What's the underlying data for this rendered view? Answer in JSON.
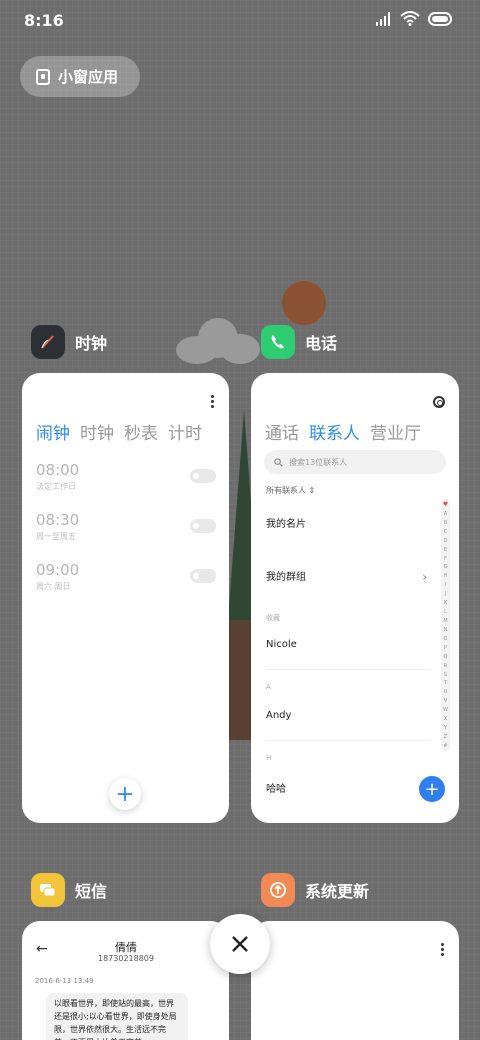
{
  "status_bar": {
    "time": "8:16"
  },
  "small_window": {
    "label": "小窗应用"
  },
  "apps": {
    "clock": {
      "name": "时钟",
      "tabs": [
        "闹钟",
        "时钟",
        "秒表",
        "计时"
      ],
      "alarms": [
        {
          "time": "08:00",
          "repeat": "法定工作日"
        },
        {
          "time": "08:30",
          "repeat": "周一至周五"
        },
        {
          "time": "09:00",
          "repeat": "周六 周日"
        }
      ],
      "add_label": "+"
    },
    "phone": {
      "name": "电话",
      "tabs": [
        "通话",
        "联系人",
        "营业厅"
      ],
      "search_placeholder": "搜索13位联系人",
      "filter_label": "所有联系人",
      "my_card": "我的名片",
      "my_groups": "我的群组",
      "favorites_label": "收藏",
      "contacts": [
        {
          "section": "",
          "name": "Nicole"
        },
        {
          "section": "A",
          "name": "Andy"
        },
        {
          "section": "H",
          "name": "哈哈"
        }
      ],
      "index_letters": [
        "♥",
        "A",
        "B",
        "C",
        "D",
        "E",
        "F",
        "G",
        "H",
        "I",
        "J",
        "K",
        "L",
        "M",
        "N",
        "O",
        "P",
        "Q",
        "R",
        "S",
        "T",
        "U",
        "V",
        "W",
        "X",
        "Y",
        "Z",
        "#"
      ],
      "add_label": "+"
    },
    "sms": {
      "name": "短信",
      "contact_name": "倩倩",
      "contact_number": "18730218809",
      "date": "2016-6-13 13:49",
      "message": "以眼看世界，即使站的最高，世界还是很小;以心看世界，即使身处局限，世界依然很大。生活远不完美，不要用太执着于完美"
    },
    "update": {
      "name": "系统更新"
    }
  },
  "colors": {
    "accent": "#2f8df2",
    "clock_icon": "#2d2f36",
    "phone_icon": "#2fcd73",
    "sms_icon": "#f3c43a",
    "update_icon": "#f28a55"
  }
}
